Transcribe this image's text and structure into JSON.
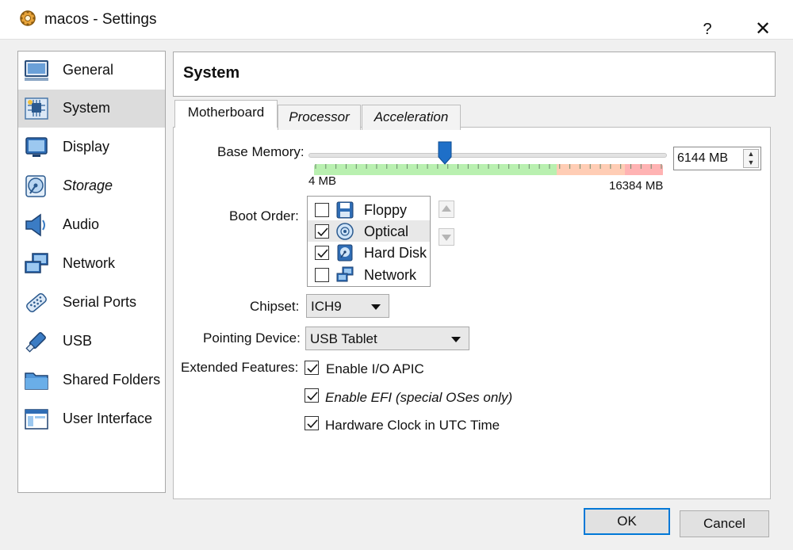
{
  "window": {
    "title": "macos - Settings",
    "help_glyph": "?",
    "close_glyph": "✕"
  },
  "sidebar": {
    "items": [
      {
        "label": "General",
        "icon": "monitor-icon"
      },
      {
        "label": "System",
        "icon": "chip-icon",
        "selected": true
      },
      {
        "label": "Display",
        "icon": "display-icon"
      },
      {
        "label": "Storage",
        "icon": "storage-icon"
      },
      {
        "label": "Audio",
        "icon": "speaker-icon"
      },
      {
        "label": "Network",
        "icon": "network-icon"
      },
      {
        "label": "Serial Ports",
        "icon": "serial-port-icon"
      },
      {
        "label": "USB",
        "icon": "usb-icon"
      },
      {
        "label": "Shared Folders",
        "icon": "folder-icon"
      },
      {
        "label": "User Interface",
        "icon": "window-icon"
      }
    ]
  },
  "header": {
    "title": "System"
  },
  "tabs": [
    {
      "label": "Motherboard",
      "active": true
    },
    {
      "label": "Processor"
    },
    {
      "label": "Acceleration"
    }
  ],
  "motherboard": {
    "base_memory": {
      "label": "Base Memory:",
      "value": "6144 MB",
      "value_mb": 6144,
      "min_label": "4 MB",
      "max_label": "16384 MB",
      "min_mb": 4,
      "max_mb": 16384
    },
    "boot_order": {
      "label": "Boot Order:",
      "items": [
        {
          "label": "Floppy",
          "checked": false,
          "icon": "floppy-icon"
        },
        {
          "label": "Optical",
          "checked": true,
          "icon": "optical-disc-icon"
        },
        {
          "label": "Hard Disk",
          "checked": true,
          "icon": "hard-disk-icon"
        },
        {
          "label": "Network",
          "checked": false,
          "icon": "network-icon"
        }
      ]
    },
    "chipset": {
      "label": "Chipset:",
      "value": "ICH9"
    },
    "pointing_device": {
      "label": "Pointing Device:",
      "value": "USB Tablet"
    },
    "extended_features": {
      "label": "Extended Features:",
      "options": [
        {
          "label": "Enable I/O APIC",
          "checked": true
        },
        {
          "label": "Enable EFI (special OSes only)",
          "checked": true
        },
        {
          "label": "Hardware Clock in UTC Time",
          "checked": true
        }
      ]
    }
  },
  "buttons": {
    "ok": "OK",
    "cancel": "Cancel"
  },
  "colors": {
    "accent": "#0078d7",
    "scale_green": "#b9f0b0",
    "scale_orange": "#ffcdb5",
    "scale_red": "#ffb3b3"
  }
}
